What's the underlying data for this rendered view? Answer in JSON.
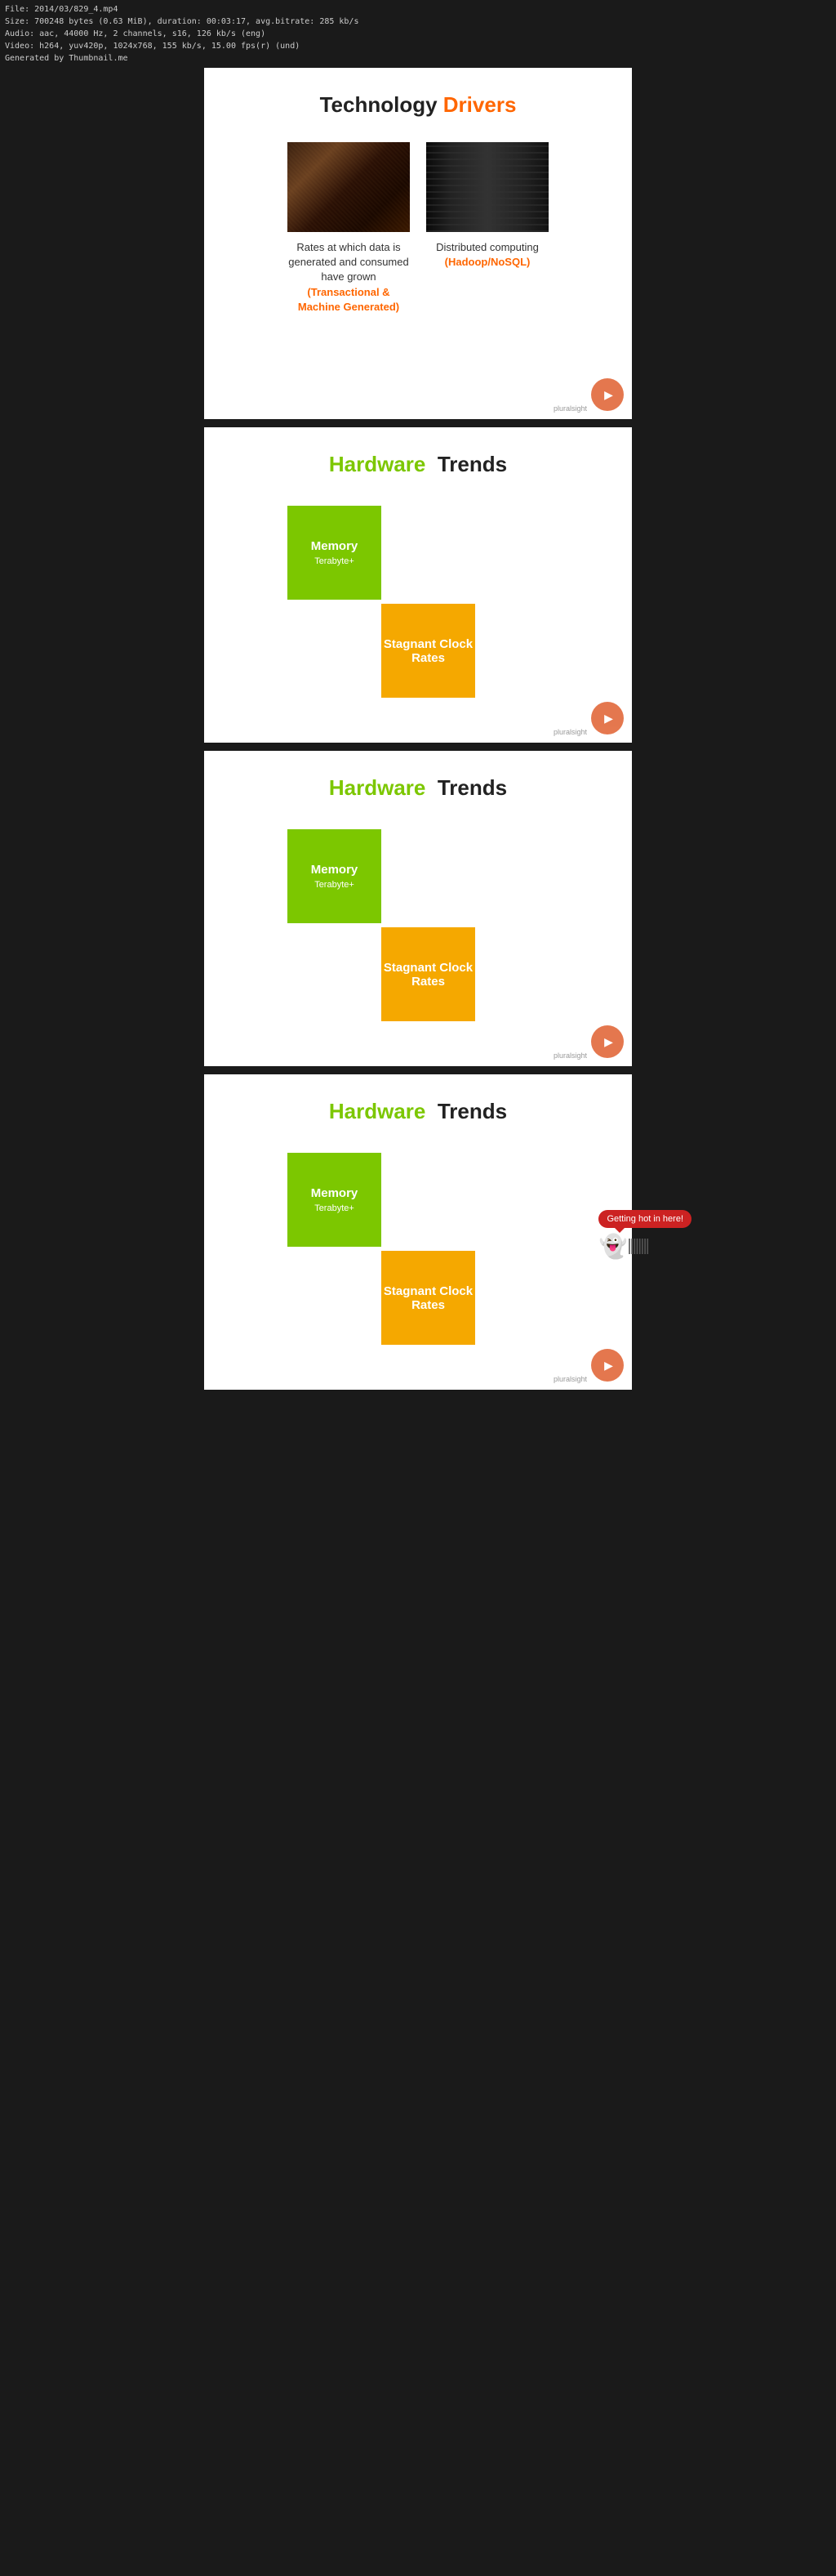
{
  "fileInfo": {
    "line1": "File: 2014/03/829_4.mp4",
    "line2": "Size: 700248 bytes (0.63 MiB), duration: 00:03:17, avg.bitrate: 285 kb/s",
    "line3": "Audio: aac, 44000 Hz, 2 channels, s16, 126 kb/s (eng)",
    "line4": "Video: h264, yuv420p, 1024x768, 155 kb/s, 15.00 fps(r) (und)",
    "line5": "Generated by Thumbnail.me"
  },
  "slide1": {
    "title_normal": "Technology",
    "title_highlight": "Drivers",
    "item1_desc": "Rates at which data is generated and consumed have grown",
    "item1_highlight": "(Transactional & Machine Generated)",
    "item2_desc": "Distributed computing",
    "item2_highlight": "(Hadoop/NoSQL)"
  },
  "slide2": {
    "title_normal": "Hardware",
    "title_highlight": "Trends",
    "box1_title": "Memory",
    "box1_sub": "Terabyte+",
    "box2_title": "Stagnant Clock Rates"
  },
  "slide3": {
    "title_normal": "Hardware",
    "title_highlight": "Trends",
    "box1_title": "Memory",
    "box1_sub": "Terabyte+",
    "box2_title": "Stagnant Clock Rates"
  },
  "slide4": {
    "title_normal": "Hardware",
    "title_highlight": "Trends",
    "box1_title": "Memory",
    "box1_sub": "Terabyte+",
    "box2_title": "Stagnant Clock Rates",
    "tooltip": "Getting hot in here!"
  },
  "pluralsight": "pluralsight"
}
